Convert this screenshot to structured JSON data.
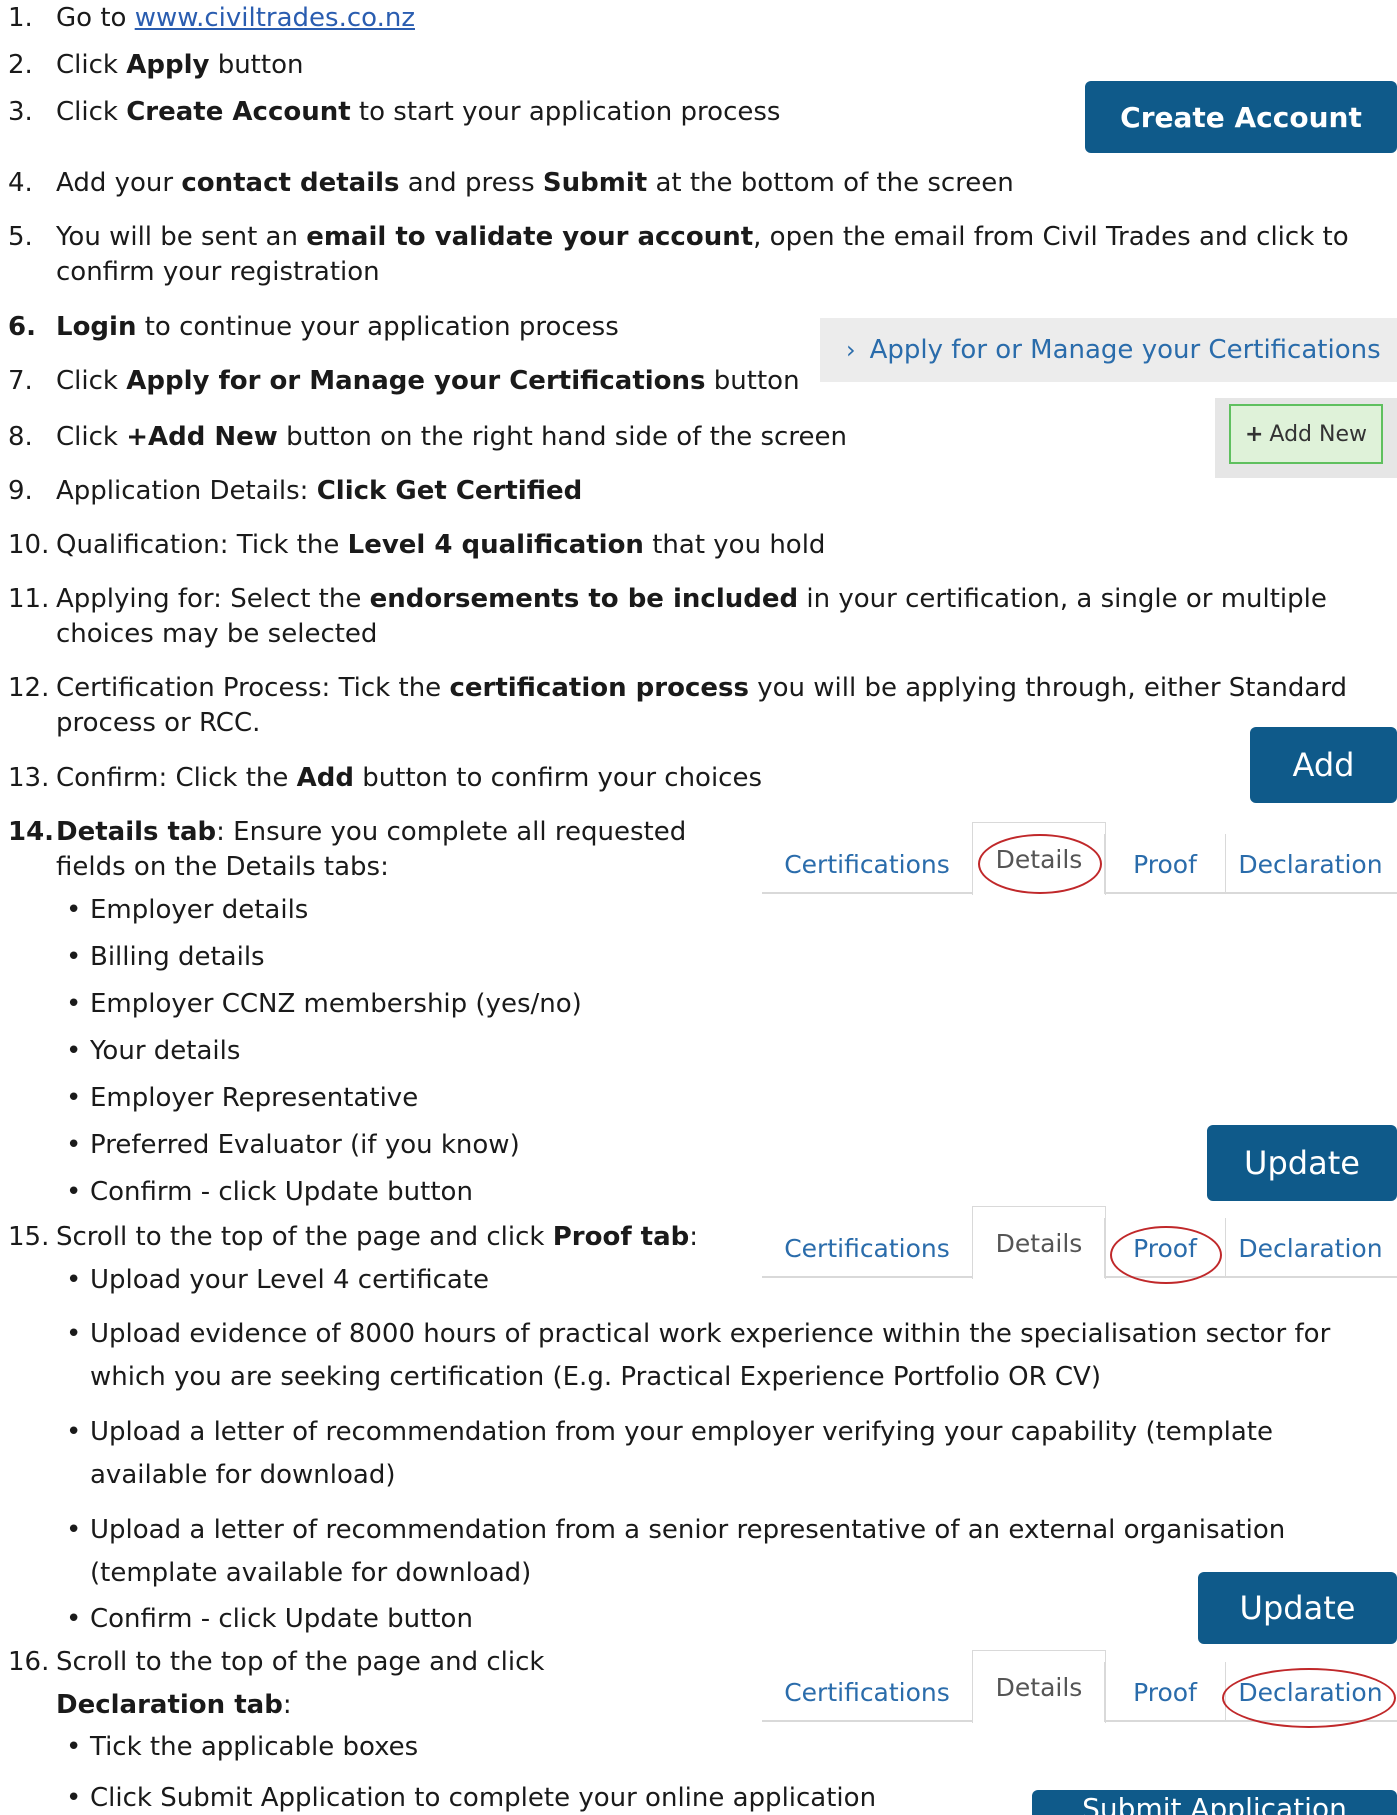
{
  "steps": {
    "s1": {
      "num": "1.",
      "text": "Go to ",
      "link": "www.civiltrades.co.nz"
    },
    "s2": {
      "num": "2.",
      "a": "Click ",
      "b": "Apply",
      "c": " button"
    },
    "s3": {
      "num": "3.",
      "a": "Click ",
      "b": "Create Account",
      "c": " to start your application process"
    },
    "s4": {
      "num": "4.",
      "a": "Add your ",
      "b": "contact details",
      "c": " and press ",
      "d": "Submit",
      "e": " at the bottom of the screen"
    },
    "s5": {
      "num": "5.",
      "a": "You will be sent an ",
      "b": "email to validate your account",
      "c": ", open the email from Civil Trades and click to",
      "cont": "confirm your registration"
    },
    "s6": {
      "num": "6.",
      "b": "Login",
      "c": " to continue your application process"
    },
    "s7": {
      "num": "7.",
      "a": "Click ",
      "b": "Apply for or Manage your Certifications",
      "c": " button"
    },
    "s8": {
      "num": "8.",
      "a": "Click ",
      "b": "+Add New",
      "c": " button on the right hand side of the screen"
    },
    "s9": {
      "num": "9.",
      "a": "Application Details: ",
      "b": "Click Get Certified"
    },
    "s10": {
      "num": "10.",
      "a": "Qualification: Tick the ",
      "b": "Level 4 qualification",
      "c": " that you hold"
    },
    "s11": {
      "num": "11.",
      "a": "Applying for: Select the ",
      "b": "endorsements to be included",
      "c": " in your certification, a single or multiple",
      "cont": "choices may be selected"
    },
    "s12": {
      "num": "12.",
      "a": "Certification Process: Tick the ",
      "b": "certification process",
      "c": " you will be applying through, either Standard",
      "cont": "process or RCC."
    },
    "s13": {
      "num": "13.",
      "a": "Confirm: Click the ",
      "b": "Add",
      "c": " button to confirm your choices"
    },
    "s14": {
      "num": "14.",
      "b": "Details tab",
      "c": ": Ensure you complete all requested",
      "cont": "fields on the Details tabs:",
      "bullets": [
        "Employer details",
        "Billing details",
        "Employer CCNZ membership (yes/no)",
        "Your details",
        "Employer Representative",
        "Preferred Evaluator (if you know)",
        "Confirm - click Update button"
      ]
    },
    "s15": {
      "num": "15.",
      "a": "Scroll to the top of the page and click ",
      "b": "Proof tab",
      "c": ":",
      "bullets": [
        "Upload your Level 4 certificate",
        "Upload evidence of 8000 hours of practical work experience within the specialisation sector for",
        "which you are seeking certification (E.g. Practical Experience Portfolio OR CV)",
        "Upload a letter of recommendation from your employer verifying your capability (template",
        "available for download)",
        "Upload a letter of recommendation from a senior representative of an external organisation",
        "(template available for download)",
        "Confirm - click Update button"
      ]
    },
    "s16": {
      "num": "16.",
      "a": "Scroll to the top of the page and click",
      "b": "Declaration tab",
      "c": ":",
      "bullets": [
        "Tick the applicable boxes",
        " Click Submit Application to complete your online application"
      ]
    }
  },
  "bullet_glyph": "•",
  "ui": {
    "create_account": "Create Account",
    "apply_manage": "Apply for or Manage your Certifications",
    "apply_chevron": "›",
    "add_new_plus": "+",
    "add_new": "Add New",
    "add": "Add",
    "update": "Update",
    "submit_application": "Submit Application",
    "tabs": [
      "Certifications",
      "Details",
      "Proof",
      "Declaration"
    ]
  },
  "colors": {
    "button_blue": "#0f5a8a",
    "link_blue": "#2a6cab",
    "highlight_ring": "#c0282a",
    "add_new_green": "#5fc05f"
  }
}
